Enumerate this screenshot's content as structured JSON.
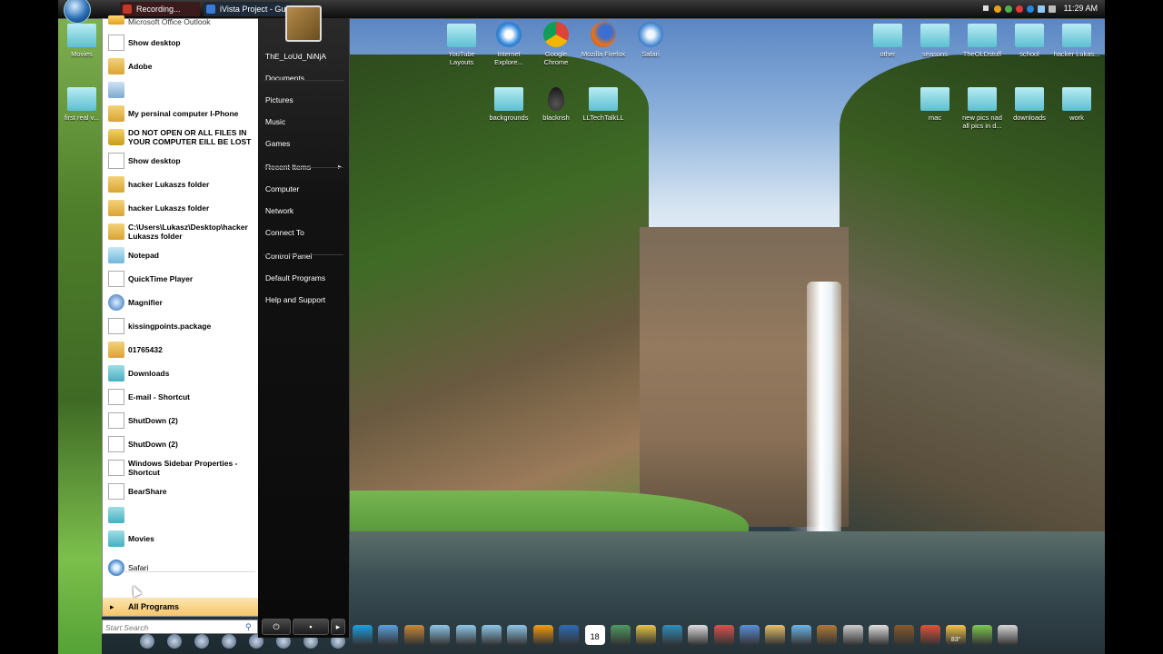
{
  "taskbar": {
    "tasks": [
      {
        "label": "Recording...",
        "color": "#c0392b"
      },
      {
        "label": "iVista Project - Guid...",
        "color": "#3a7bd5"
      }
    ],
    "clock": "11:29 AM"
  },
  "start_menu": {
    "pinned_partial": "Microsoft Office Outlook",
    "programs": [
      {
        "label": "Show desktop",
        "icon": "doc-icon"
      },
      {
        "label": "Adobe",
        "icon": "folder-icon"
      },
      {
        "label": "",
        "icon": "recycle-bin-icon"
      },
      {
        "label": "My persinal computer I-Phone",
        "icon": "folder-icon"
      },
      {
        "label": "DO NOT OPEN OR ALL FILES IN YOUR COMPUTER EILL BE LOST",
        "icon": "lock-icon"
      },
      {
        "label": "Show desktop",
        "icon": "doc-icon"
      },
      {
        "label": "hacker Lukaszs folder",
        "icon": "folder-icon"
      },
      {
        "label": "hacker Lukaszs folder",
        "icon": "folder-icon"
      },
      {
        "label": "C:\\Users\\Lukasz\\Desktop\\hacker Lukaszs folder",
        "icon": "folder-icon"
      },
      {
        "label": "Notepad",
        "icon": "notepad-icon"
      },
      {
        "label": "QuickTime Player",
        "icon": "doc-icon"
      },
      {
        "label": "Magnifier",
        "icon": "magnifier-icon"
      },
      {
        "label": "kissingpoints.package",
        "icon": "doc-icon"
      },
      {
        "label": "01765432",
        "icon": "folder-icon"
      },
      {
        "label": "Downloads",
        "icon": "folder-cyan-icon"
      },
      {
        "label": "E-mail - Shortcut",
        "icon": "doc-icon"
      },
      {
        "label": "ShutDown (2)",
        "icon": "doc-icon"
      },
      {
        "label": "ShutDown (2)",
        "icon": "doc-icon"
      },
      {
        "label": "Windows Sidebar Properties - Shortcut",
        "icon": "doc-icon"
      },
      {
        "label": "BearShare",
        "icon": "doc-icon"
      },
      {
        "label": "",
        "icon": "folder-cyan-icon"
      },
      {
        "label": "Movies",
        "icon": "folder-cyan-icon"
      }
    ],
    "recent": {
      "label": "Safari",
      "icon": "safari-icon"
    },
    "all_programs": "All Programs",
    "search_placeholder": "Start Search",
    "places": [
      {
        "label": "ThE_LoUd_NiNjA",
        "submenu": false
      },
      {
        "label": "Documents",
        "submenu": false
      },
      {
        "label": "Pictures",
        "submenu": false
      },
      {
        "label": "Music",
        "submenu": false
      },
      {
        "label": "Games",
        "submenu": false
      },
      {
        "label": "Recent Items",
        "submenu": true
      },
      {
        "label": "Computer",
        "submenu": false
      },
      {
        "label": "Network",
        "submenu": false
      },
      {
        "label": "Connect To",
        "submenu": false
      },
      {
        "label": "Control Panel",
        "submenu": false
      },
      {
        "label": "Default Programs",
        "submenu": false
      },
      {
        "label": "Help and Support",
        "submenu": false
      }
    ],
    "power_symbol": "⏻",
    "lock_symbol": "🔒",
    "more_symbol": "▸"
  },
  "desktop": {
    "icons": [
      {
        "label": "Movies",
        "type": "folder"
      },
      {
        "label": "first real v...",
        "type": "folder"
      },
      {
        "label": "YouTube Layouts",
        "type": "folder"
      },
      {
        "label": "Internet Explore...",
        "type": "ie"
      },
      {
        "label": "Google Chrome",
        "type": "chrome"
      },
      {
        "label": "Mozilla Firefox",
        "type": "firefox"
      },
      {
        "label": "Safari",
        "type": "safari"
      },
      {
        "label": "backgrounds",
        "type": "folder"
      },
      {
        "label": "blacknsh",
        "type": "drop"
      },
      {
        "label": "LLTechTalkLL",
        "type": "folder"
      },
      {
        "label": "other",
        "type": "folder"
      },
      {
        "label": "seasons",
        "type": "folder"
      },
      {
        "label": "TheOLDstuff",
        "type": "folder"
      },
      {
        "label": "school",
        "type": "folder"
      },
      {
        "label": "hacker Lukas...",
        "type": "folder"
      },
      {
        "label": "mac",
        "type": "folder"
      },
      {
        "label": "new pics nad all pics in d...",
        "type": "folder"
      },
      {
        "label": "downloads",
        "type": "folder"
      },
      {
        "label": "work",
        "type": "folder"
      }
    ]
  },
  "dock": {
    "items": [
      {
        "name": "skype-icon",
        "color": "#1ba1e2"
      },
      {
        "name": "messenger-icon",
        "color": "#5aa0e0"
      },
      {
        "name": "paint-icon",
        "color": "#c88a3a"
      },
      {
        "name": "folder-icon",
        "color": "#8fc7e8"
      },
      {
        "name": "folder-icon",
        "color": "#8fc7e8"
      },
      {
        "name": "folder-icon",
        "color": "#8fc7e8"
      },
      {
        "name": "folder-icon",
        "color": "#8fc7e8"
      },
      {
        "name": "media-icon",
        "color": "#f39c12"
      },
      {
        "name": "word-icon",
        "color": "#2e6bb6"
      },
      {
        "name": "calendar-icon",
        "color": "#ffffff"
      },
      {
        "name": "photo-icon",
        "color": "#4e9a62"
      },
      {
        "name": "pencil-icon",
        "color": "#e7c447"
      },
      {
        "name": "globe-icon",
        "color": "#2d8fbf"
      },
      {
        "name": "blank-icon",
        "color": "#dddddd"
      },
      {
        "name": "target-icon",
        "color": "#d9534f"
      },
      {
        "name": "finder-icon",
        "color": "#5a8fd8"
      },
      {
        "name": "notes-icon",
        "color": "#e6c26a"
      },
      {
        "name": "cube-icon",
        "color": "#6fb6e8"
      },
      {
        "name": "preview-icon",
        "color": "#b07a3a"
      },
      {
        "name": "xray-icon",
        "color": "#cccccc"
      },
      {
        "name": "gamepad-icon",
        "color": "#e0e0e0"
      },
      {
        "name": "avatar-icon",
        "color": "#8a5a2a"
      },
      {
        "name": "mushroom-icon",
        "color": "#e0533a"
      },
      {
        "name": "weather-icon",
        "color": "#f3c44a"
      },
      {
        "name": "battery-icon",
        "color": "#7ec850"
      },
      {
        "name": "trash-icon",
        "color": "#d6d6d6"
      }
    ],
    "calendar_day": "18",
    "weather_temp": "83°"
  }
}
